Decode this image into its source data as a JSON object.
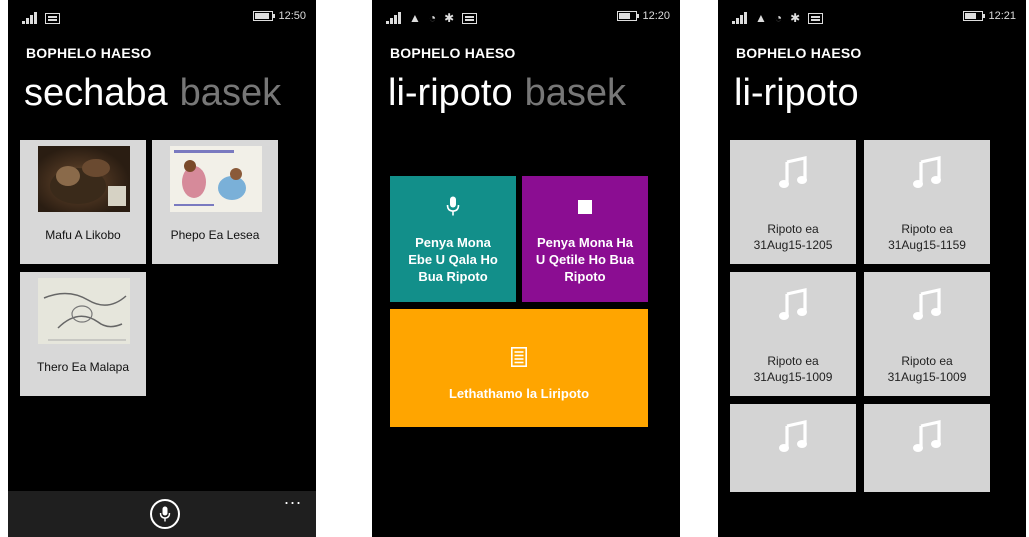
{
  "screens": [
    {
      "status": {
        "time": "12:50"
      },
      "app_title": "BOPHELO HAESO",
      "pivot": {
        "active": "sechaba",
        "next": "basek"
      },
      "tiles": [
        {
          "label": "Mafu A Likobo"
        },
        {
          "label": "Phepo Ea Lesea"
        },
        {
          "label": "Thero Ea Malapa"
        }
      ],
      "appbar": {
        "more": "..."
      }
    },
    {
      "status": {
        "time": "12:20"
      },
      "app_title": "BOPHELO HAESO",
      "pivot": {
        "active": "li-ripoto",
        "next": "basek"
      },
      "actions": {
        "start": {
          "line1": "Penya Mona",
          "line2": "Ebe U Qala Ho",
          "line3": "Bua Ripoto",
          "color": "#128f8a"
        },
        "stop": {
          "line1": "Penya Mona Ha",
          "line2": "U Qetile Ho Bua",
          "line3": "Ripoto",
          "color": "#8b0d92"
        },
        "list": {
          "label": "Lethathamo la Liripoto",
          "color": "#ffa500"
        }
      }
    },
    {
      "status": {
        "time": "12:21"
      },
      "app_title": "BOPHELO HAESO",
      "pivot": {
        "active": "li-ripoto"
      },
      "reports": [
        {
          "line1": "Ripoto ea",
          "line2": "31Aug15-1205"
        },
        {
          "line1": "Ripoto ea",
          "line2": "31Aug15-1159"
        },
        {
          "line1": "Ripoto ea",
          "line2": "31Aug15-1009"
        },
        {
          "line1": "Ripoto ea",
          "line2": "31Aug15-1009"
        },
        {
          "line1": "",
          "line2": ""
        },
        {
          "line1": "",
          "line2": ""
        }
      ]
    }
  ]
}
